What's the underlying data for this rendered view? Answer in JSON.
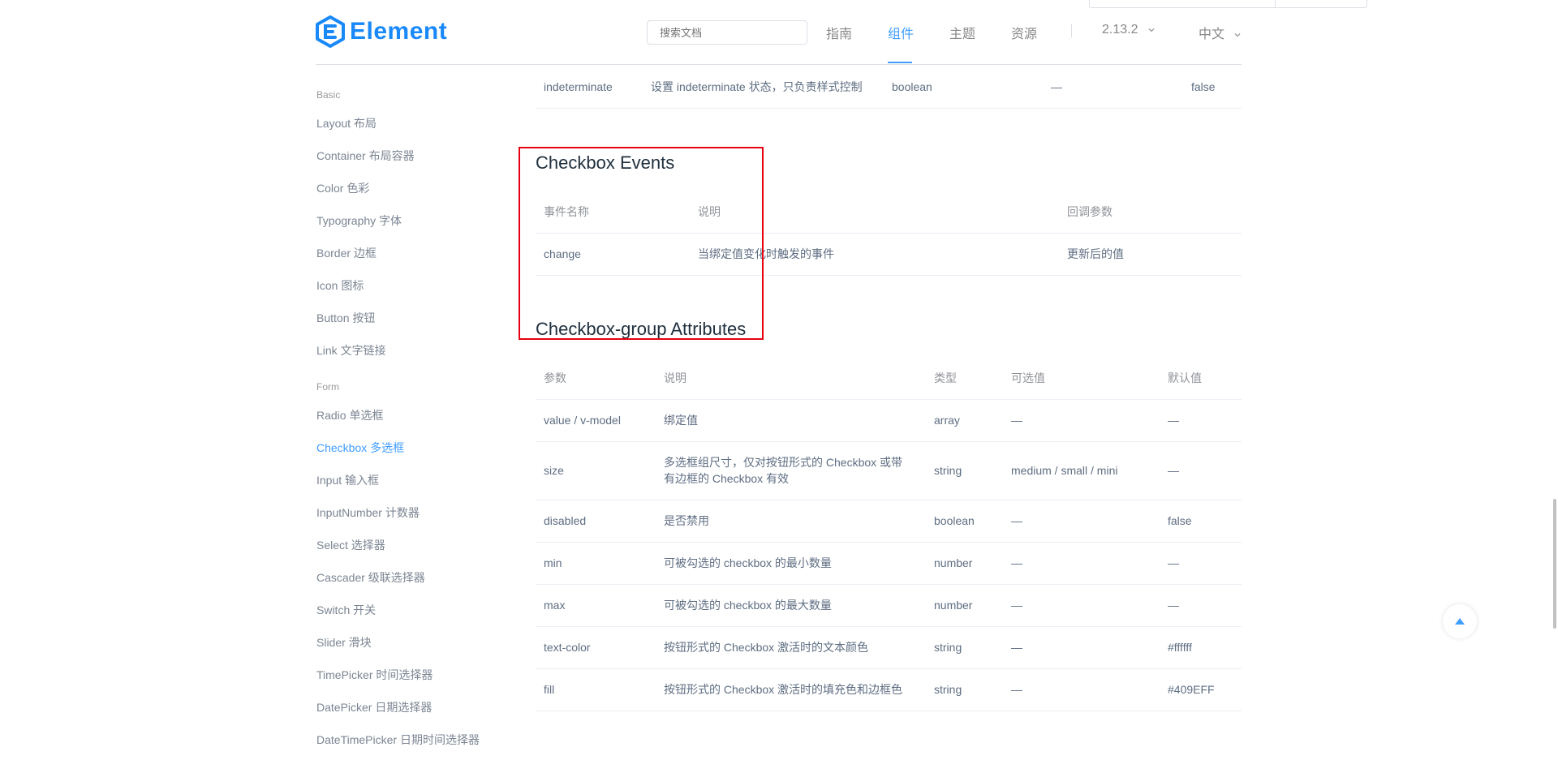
{
  "header": {
    "brand": "Element",
    "search_placeholder": "搜索文档",
    "nav": [
      "指南",
      "组件",
      "主题",
      "资源"
    ],
    "version": "2.13.2",
    "language": "中文",
    "accent": "#409EFF"
  },
  "sidebar": {
    "groups": [
      {
        "label": "Basic",
        "items": [
          "Layout 布局",
          "Container 布局容器",
          "Color 色彩",
          "Typography 字体",
          "Border 边框",
          "Icon 图标",
          "Button 按钮",
          "Link 文字链接"
        ]
      },
      {
        "label": "Form",
        "items": [
          "Radio 单选框",
          "Checkbox 多选框",
          "Input 输入框",
          "InputNumber 计数器",
          "Select 选择器",
          "Cascader 级联选择器",
          "Switch 开关",
          "Slider 滑块",
          "TimePicker 时间选择器",
          "DatePicker 日期选择器",
          "DateTimePicker 日期时间选择器"
        ]
      }
    ],
    "active": "Checkbox 多选框"
  },
  "prev_table_row": [
    "indeterminate",
    "设置 indeterminate 状态，只负责样式控制",
    "boolean",
    "—",
    "false"
  ],
  "events": {
    "title": "Checkbox Events",
    "headers": [
      "事件名称",
      "说明",
      "回调参数"
    ],
    "rows": [
      [
        "change",
        "当绑定值变化时触发的事件",
        "更新后的值"
      ]
    ]
  },
  "group_attributes": {
    "title": "Checkbox-group Attributes",
    "headers": [
      "参数",
      "说明",
      "类型",
      "可选值",
      "默认值"
    ],
    "rows": [
      [
        "value / v-model",
        "绑定值",
        "array",
        "—",
        "—"
      ],
      [
        "size",
        "多选框组尺寸，仅对按钮形式的 Checkbox 或带有边框的 Checkbox 有效",
        "string",
        "medium / small / mini",
        "—"
      ],
      [
        "disabled",
        "是否禁用",
        "boolean",
        "—",
        "false"
      ],
      [
        "min",
        "可被勾选的 checkbox 的最小数量",
        "number",
        "—",
        "—"
      ],
      [
        "max",
        "可被勾选的 checkbox 的最大数量",
        "number",
        "—",
        "—"
      ],
      [
        "text-color",
        "按钮形式的 Checkbox 激活时的文本颜色",
        "string",
        "—",
        "#ffffff"
      ],
      [
        "fill",
        "按钮形式的 Checkbox 激活时的填充色和边框色",
        "string",
        "—",
        "#409EFF"
      ]
    ]
  }
}
